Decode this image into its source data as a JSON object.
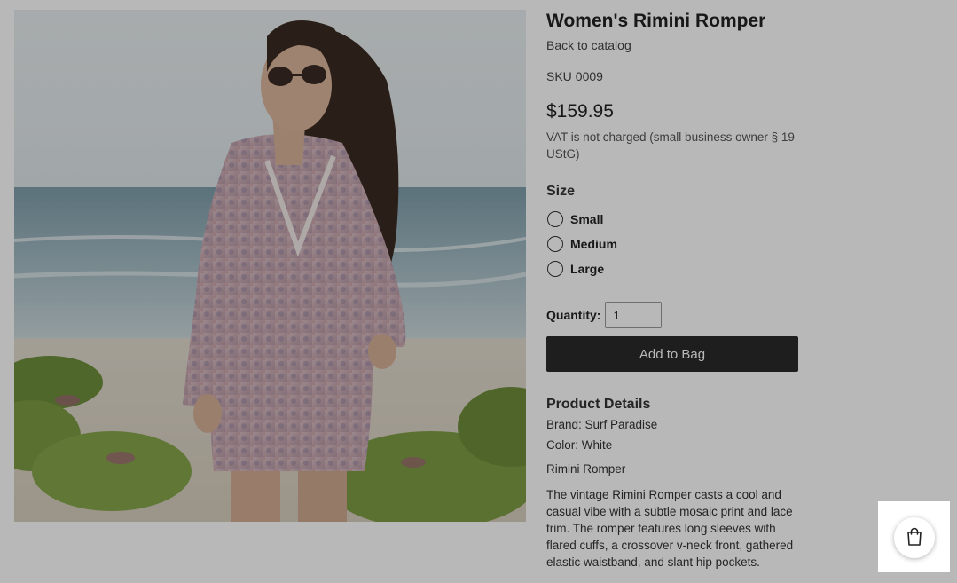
{
  "product": {
    "title": "Women's Rimini Romper",
    "back_link": "Back to catalog",
    "sku_label": "SKU",
    "sku_value": "0009",
    "price": "$159.95",
    "vat_note": "VAT is not charged (small business owner § 19 UStG)"
  },
  "size": {
    "heading": "Size",
    "options": [
      "Small",
      "Medium",
      "Large"
    ]
  },
  "quantity": {
    "label": "Quantity:",
    "value": "1"
  },
  "add_to_bag_label": "Add to Bag",
  "details": {
    "heading": "Product Details",
    "brand": "Brand: Surf Paradise",
    "color": "Color: White",
    "subheading": "Rimini Romper",
    "description": "The vintage Rimini Romper casts a cool and casual vibe with a subtle mosaic print and lace trim. The romper features long sleeves with flared cuffs, a crossover v-neck front, gathered elastic waistband, and slant hip pockets."
  },
  "cart": {
    "icon": "shopping-bag-icon"
  },
  "colors": {
    "button_bg": "#2a2a2a",
    "overlay": "rgba(0,0,0,0.28)"
  }
}
